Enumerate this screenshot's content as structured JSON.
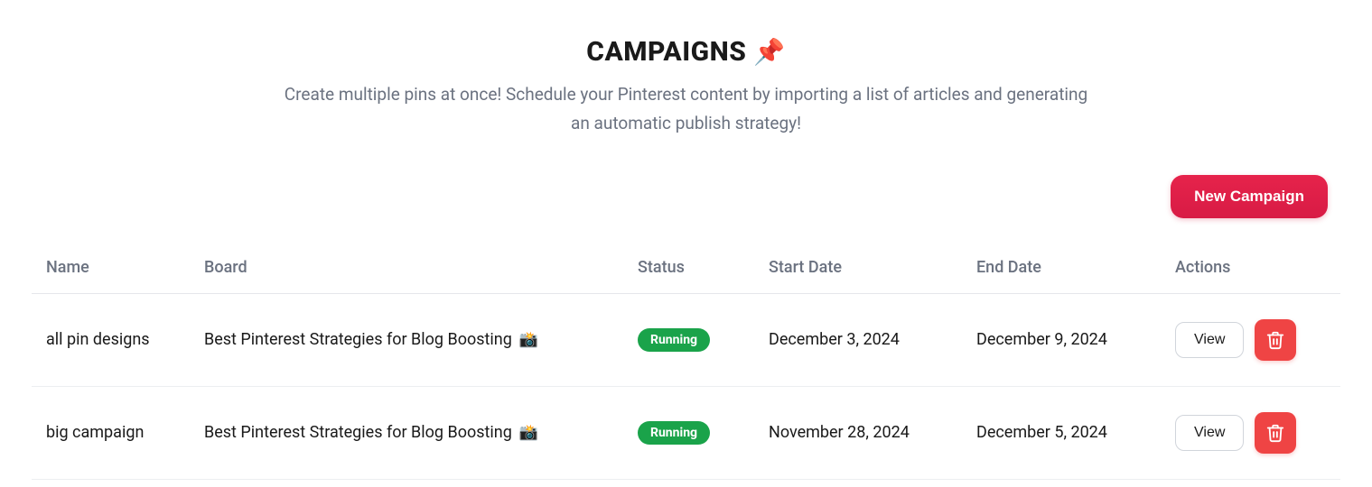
{
  "header": {
    "title": "CAMPAIGNS",
    "icon": "📌",
    "subtitle": "Create multiple pins at once! Schedule your Pinterest content by importing a list of articles and generating an automatic publish strategy!"
  },
  "toolbar": {
    "new_campaign_label": "New Campaign"
  },
  "table": {
    "columns": {
      "name": "Name",
      "board": "Board",
      "status": "Status",
      "start_date": "Start Date",
      "end_date": "End Date",
      "actions": "Actions"
    },
    "rows": [
      {
        "name": "all pin designs",
        "board": "Best Pinterest Strategies for Blog Boosting",
        "board_icon": "📸",
        "status": "Running",
        "start_date": "December 3, 2024",
        "end_date": "December 9, 2024",
        "view_label": "View"
      },
      {
        "name": "big campaign",
        "board": "Best Pinterest Strategies for Blog Boosting",
        "board_icon": "📸",
        "status": "Running",
        "start_date": "November 28, 2024",
        "end_date": "December 5, 2024",
        "view_label": "View"
      }
    ]
  }
}
